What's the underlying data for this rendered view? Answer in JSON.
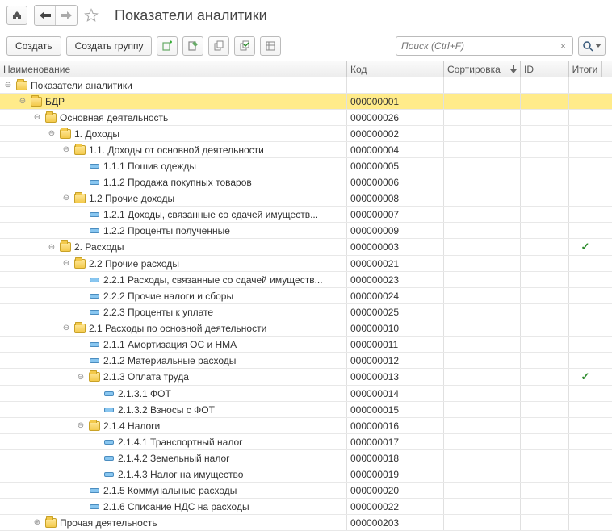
{
  "title": "Показатели аналитики",
  "toolbar": {
    "create": "Создать",
    "create_group": "Создать группу",
    "search_placeholder": "Поиск (Ctrl+F)"
  },
  "columns": {
    "name": "Наименование",
    "code": "Код",
    "sort": "Сортировка",
    "id": "ID",
    "totals": "Итоги"
  },
  "rows": [
    {
      "indent": 0,
      "toggle": "minus",
      "icon": "folder",
      "name": "Показатели аналитики",
      "code": "",
      "tot": false,
      "selected": false
    },
    {
      "indent": 1,
      "toggle": "minus",
      "icon": "folder",
      "name": "БДР",
      "code": "000000001",
      "tot": false,
      "selected": true
    },
    {
      "indent": 2,
      "toggle": "minus",
      "icon": "folder",
      "name": "Основная деятельность",
      "code": "000000026",
      "tot": false
    },
    {
      "indent": 3,
      "toggle": "minus",
      "icon": "folder",
      "name": "1. Доходы",
      "code": "000000002",
      "tot": false
    },
    {
      "indent": 4,
      "toggle": "minus",
      "icon": "folder",
      "name": "1.1. Доходы от основной деятельности",
      "code": "000000004",
      "tot": false
    },
    {
      "indent": 5,
      "toggle": "none",
      "icon": "leaf",
      "name": "1.1.1 Пошив одежды",
      "code": "000000005",
      "tot": false
    },
    {
      "indent": 5,
      "toggle": "none",
      "icon": "leaf",
      "name": "1.1.2 Продажа покупных товаров",
      "code": "000000006",
      "tot": false
    },
    {
      "indent": 4,
      "toggle": "minus",
      "icon": "folder",
      "name": "1.2 Прочие доходы",
      "code": "000000008",
      "tot": false
    },
    {
      "indent": 5,
      "toggle": "none",
      "icon": "leaf",
      "name": "1.2.1 Доходы, связанные со сдачей имуществ...",
      "code": "000000007",
      "tot": false
    },
    {
      "indent": 5,
      "toggle": "none",
      "icon": "leaf",
      "name": "1.2.2 Проценты полученные",
      "code": "000000009",
      "tot": false
    },
    {
      "indent": 3,
      "toggle": "minus",
      "icon": "folder",
      "name": "2. Расходы",
      "code": "000000003",
      "tot": true
    },
    {
      "indent": 4,
      "toggle": "minus",
      "icon": "folder",
      "name": "2.2 Прочие расходы",
      "code": "000000021",
      "tot": false
    },
    {
      "indent": 5,
      "toggle": "none",
      "icon": "leaf",
      "name": "2.2.1 Расходы, связанные со сдачей имуществ...",
      "code": "000000023",
      "tot": false
    },
    {
      "indent": 5,
      "toggle": "none",
      "icon": "leaf",
      "name": "2.2.2 Прочие налоги и сборы",
      "code": "000000024",
      "tot": false
    },
    {
      "indent": 5,
      "toggle": "none",
      "icon": "leaf",
      "name": "2.2.3 Проценты к уплате",
      "code": "000000025",
      "tot": false
    },
    {
      "indent": 4,
      "toggle": "minus",
      "icon": "folder",
      "name": "2.1 Расходы по основной деятельности",
      "code": "000000010",
      "tot": false
    },
    {
      "indent": 5,
      "toggle": "none",
      "icon": "leaf",
      "name": "2.1.1 Амортизация ОС и НМА",
      "code": "000000011",
      "tot": false
    },
    {
      "indent": 5,
      "toggle": "none",
      "icon": "leaf",
      "name": "2.1.2 Материальные расходы",
      "code": "000000012",
      "tot": false
    },
    {
      "indent": 5,
      "toggle": "minus",
      "icon": "folder",
      "name": "2.1.3 Оплата труда",
      "code": "000000013",
      "tot": true
    },
    {
      "indent": 6,
      "toggle": "none",
      "icon": "leaf",
      "name": "2.1.3.1 ФОТ",
      "code": "000000014",
      "tot": false
    },
    {
      "indent": 6,
      "toggle": "none",
      "icon": "leaf",
      "name": "2.1.3.2 Взносы с ФОТ",
      "code": "000000015",
      "tot": false
    },
    {
      "indent": 5,
      "toggle": "minus",
      "icon": "folder",
      "name": "2.1.4 Налоги",
      "code": "000000016",
      "tot": false
    },
    {
      "indent": 6,
      "toggle": "none",
      "icon": "leaf",
      "name": "2.1.4.1 Транспортный налог",
      "code": "000000017",
      "tot": false
    },
    {
      "indent": 6,
      "toggle": "none",
      "icon": "leaf",
      "name": "2.1.4.2 Земельный налог",
      "code": "000000018",
      "tot": false
    },
    {
      "indent": 6,
      "toggle": "none",
      "icon": "leaf",
      "name": "2.1.4.3 Налог на имущество",
      "code": "000000019",
      "tot": false
    },
    {
      "indent": 5,
      "toggle": "none",
      "icon": "leaf",
      "name": "2.1.5 Коммунальные расходы",
      "code": "000000020",
      "tot": false
    },
    {
      "indent": 5,
      "toggle": "none",
      "icon": "leaf",
      "name": "2.1.6 Списание НДС на расходы",
      "code": "000000022",
      "tot": false
    },
    {
      "indent": 2,
      "toggle": "plus",
      "icon": "folder",
      "name": "Прочая деятельность",
      "code": "000000203",
      "tot": false
    }
  ]
}
